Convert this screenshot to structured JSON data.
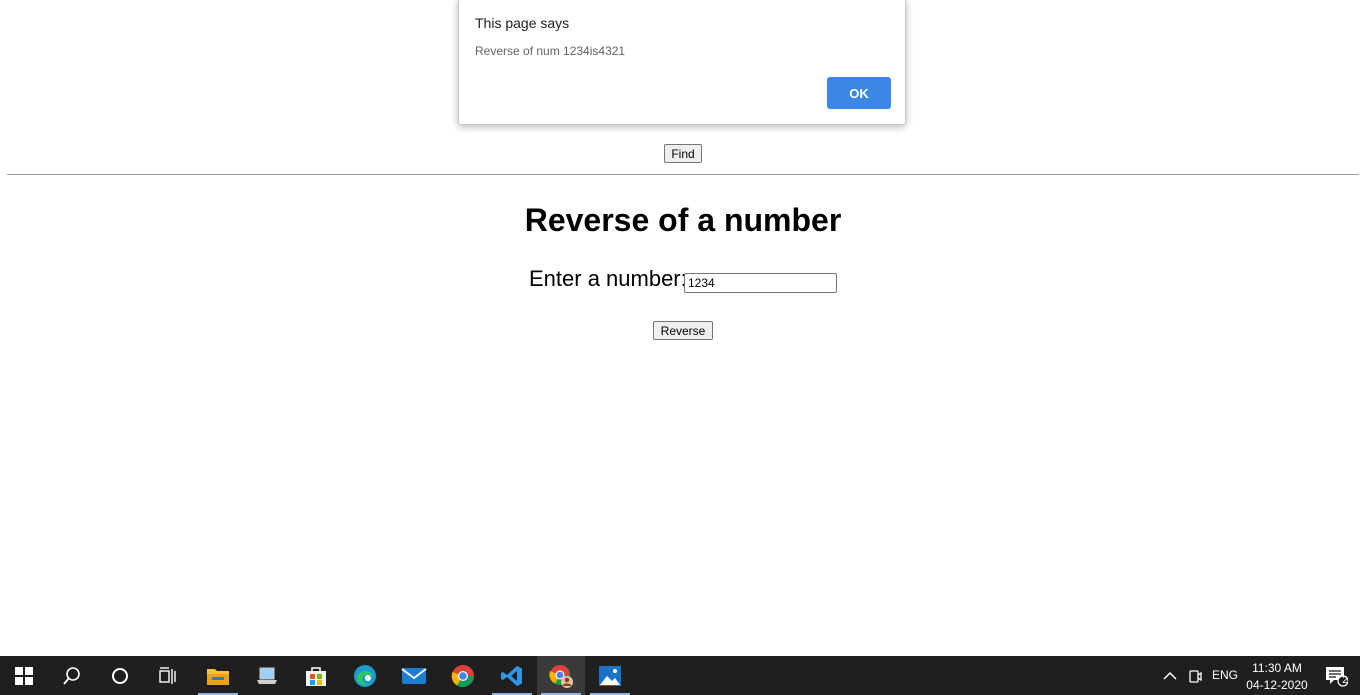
{
  "dialog": {
    "title": "This page says",
    "message": "Reverse of num 1234is4321",
    "ok_label": "OK"
  },
  "find_button": "Find",
  "heading": "Reverse of a number",
  "form": {
    "label": "Enter a number:",
    "value": "1234",
    "submit_label": "Reverse"
  },
  "taskbar": {
    "icons": [
      "windows-start-icon",
      "search-icon",
      "cortana-icon",
      "task-view-icon",
      "file-explorer-icon",
      "laptop-app-icon",
      "store-icon",
      "edge-icon",
      "mail-icon",
      "chrome-icon",
      "vscode-icon",
      "chrome-profile-icon",
      "photos-icon"
    ],
    "language": "ENG",
    "time": "11:30 AM",
    "date": "04-12-2020",
    "notification_count": "2"
  }
}
